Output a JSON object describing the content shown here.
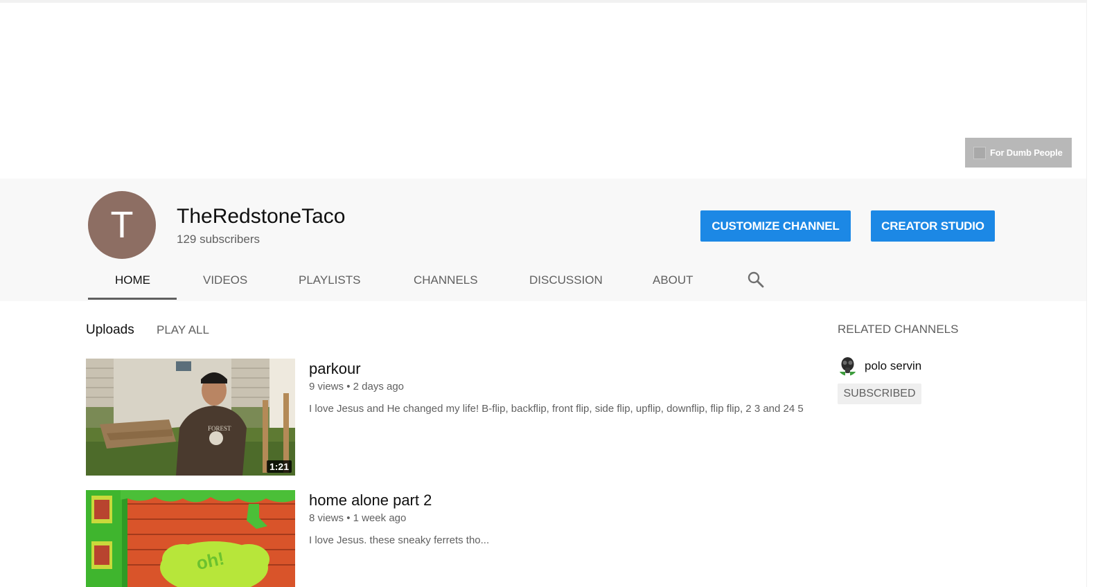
{
  "banner": {
    "link_label": "For Dumb People"
  },
  "channel": {
    "avatar_letter": "T",
    "name": "TheRedstoneTaco",
    "subscribers": "129 subscribers",
    "customize_label": "CUSTOMIZE CHANNEL",
    "studio_label": "CREATOR STUDIO"
  },
  "tabs": [
    {
      "label": "HOME",
      "active": true
    },
    {
      "label": "VIDEOS"
    },
    {
      "label": "PLAYLISTS"
    },
    {
      "label": "CHANNELS"
    },
    {
      "label": "DISCUSSION"
    },
    {
      "label": "ABOUT"
    }
  ],
  "uploads": {
    "title": "Uploads",
    "play_all": "PLAY ALL",
    "videos": [
      {
        "title": "parkour",
        "views": "9 views",
        "age": "2 days ago",
        "description": "I love Jesus and He changed my life! B-flip, backflip, front flip, side flip, upflip, downflip, flip flip, 2 3 and 24 5",
        "duration": "1:21"
      },
      {
        "title": "home alone part 2",
        "views": "8 views",
        "age": "1 week ago",
        "description": "I love Jesus. these sneaky ferrets tho..."
      }
    ]
  },
  "related": {
    "title": "RELATED CHANNELS",
    "channels": [
      {
        "name": "polo servin",
        "button": "SUBSCRIBED"
      }
    ]
  },
  "colors": {
    "primary_button": "#1c88e5",
    "avatar_bg": "#8d6e63",
    "header_bg": "#f8f8f8"
  }
}
